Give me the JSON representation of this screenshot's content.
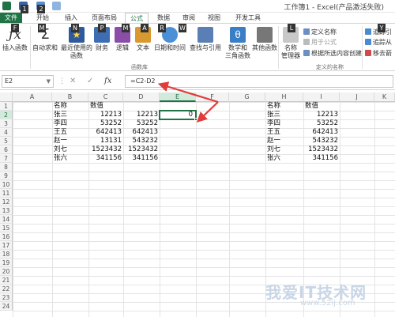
{
  "window": {
    "title": "工作簿1 - Excel(产品激活失败)"
  },
  "keytips": [
    "1",
    "2",
    "F",
    "M",
    "N",
    "P",
    "M",
    "A",
    "R",
    "W",
    "L",
    "Y"
  ],
  "tabs": [
    {
      "label": "文件"
    },
    {
      "label": "开始"
    },
    {
      "label": "插入"
    },
    {
      "label": "页面布局"
    },
    {
      "label": "公式"
    },
    {
      "label": "数据"
    },
    {
      "label": "审阅"
    },
    {
      "label": "视图"
    },
    {
      "label": "开发工具"
    }
  ],
  "ribbon": {
    "insert_function": "插入函数",
    "autosum": "自动求和",
    "recent": "最近使用的\n函数",
    "recent_l1": "最近使用的",
    "recent_l2": "函数",
    "financial": "财务",
    "logical": "逻辑",
    "text": "文本",
    "datetime": "日期和时间",
    "lookup": "查找与引用",
    "math_l1": "数学和",
    "math_l2": "三角函数",
    "more": "其他函数",
    "function_library_label": "函数库",
    "name_manager_l1": "名称",
    "name_manager_l2": "管理器",
    "define_name": "定义名称",
    "use_in_formula": "用于公式",
    "create_from_selection": "根据所选内容创建",
    "defined_names_label": "定义的名称",
    "trace_precedents": "追踪引",
    "trace_dependents": "追踪从",
    "remove_arrows": "移去箭"
  },
  "formula_bar": {
    "name_box": "E2",
    "formula": "=C2-D2",
    "fx": "fx"
  },
  "columns": [
    "A",
    "B",
    "C",
    "D",
    "E",
    "F",
    "G",
    "H",
    "I",
    "J",
    "K"
  ],
  "selected_column": "E",
  "rows": [
    "1",
    "2",
    "3",
    "4",
    "5",
    "6",
    "7",
    "8",
    "9",
    "10",
    "11",
    "12",
    "13",
    "14",
    "15",
    "16",
    "17",
    "18",
    "19",
    "20",
    "21",
    "22",
    "23",
    "24"
  ],
  "selected_row": "2",
  "table_left": {
    "headers": [
      "名称",
      "数值"
    ],
    "rows": [
      {
        "name": "张三",
        "c": "12213",
        "d": "12213",
        "e": "0"
      },
      {
        "name": "李四",
        "c": "53252",
        "d": "53252",
        "e": ""
      },
      {
        "name": "王五",
        "c": "642413",
        "d": "642413",
        "e": ""
      },
      {
        "name": "赵一",
        "c": "13131",
        "d": "543232",
        "e": ""
      },
      {
        "name": "刘七",
        "c": "1523432",
        "d": "1523432",
        "e": ""
      },
      {
        "name": "张六",
        "c": "341156",
        "d": "341156",
        "e": ""
      }
    ]
  },
  "table_right": {
    "headers": [
      "名称",
      "数值"
    ],
    "rows": [
      {
        "name": "张三",
        "value": "12213"
      },
      {
        "name": "李四",
        "value": "53252"
      },
      {
        "name": "王五",
        "value": "642413"
      },
      {
        "name": "赵一",
        "value": "543232"
      },
      {
        "name": "刘七",
        "value": "1523432"
      },
      {
        "name": "张六",
        "value": "341156"
      }
    ]
  },
  "watermark": {
    "text": "我爱IT技术网",
    "url": "www.52ij.com"
  },
  "colors": {
    "excel_green": "#217346",
    "arrow_red": "#e03c3c"
  }
}
